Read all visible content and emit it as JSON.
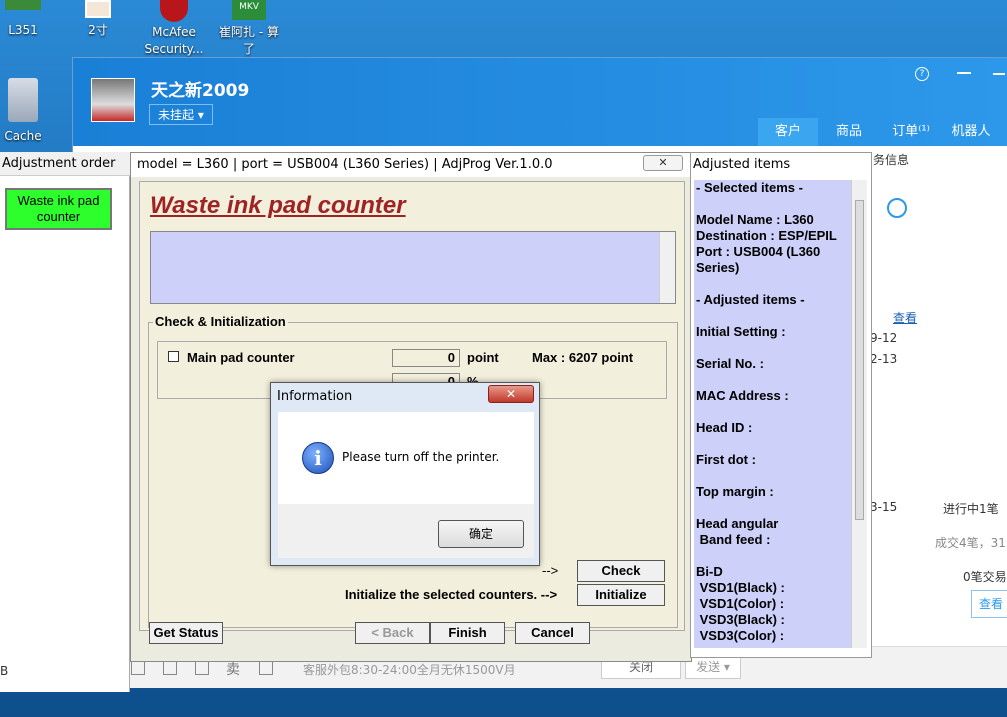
{
  "desktop": {
    "icons": [
      {
        "label": "L351",
        "icon": "app-icon"
      },
      {
        "label": "2寸",
        "icon": "photo-icon"
      },
      {
        "label": "McAfee Security...",
        "icon": "mcafee-shield-icon"
      },
      {
        "label": "崔阿扎 - 算了",
        "icon": "mkv-file-icon"
      },
      {
        "label": "Cache",
        "icon": "folder-icon"
      }
    ]
  },
  "qq": {
    "name": "天之新2009",
    "status": "未挂起 ▾",
    "tabs": [
      "客户",
      "商品",
      "订单⁽¹⁾",
      "机器人"
    ],
    "bottom_text": "客服外包8:30-24:00全月无休1500V月",
    "close_label": "关闭",
    "send_label": "发送 ▾",
    "right": {
      "info_heading": "务信息",
      "view_link": "查看",
      "date1": "9-12",
      "date2": "2-13",
      "date3": "3-15",
      "in_progress": "进行中1笔",
      "deals": "成交4笔，31",
      "deals2": "0笔交易",
      "view_btn": "查看"
    },
    "left_bottom": "B"
  },
  "adjust_order": {
    "title": "Adjustment order",
    "waste_button": "Waste ink pad counter"
  },
  "adjprog": {
    "title": "model = L360 | port = USB004 (L360 Series) | AdjProg Ver.1.0.0",
    "close_glyph": "✕",
    "heading": "Waste ink pad counter",
    "group_label": "Check & Initialization",
    "main_pad_label": "Main pad counter",
    "point_value": "0",
    "point_unit": "point",
    "max_text": "Max : 6207 point",
    "percent_value": "0",
    "percent_unit": "%",
    "check_arrow": "-->",
    "check_button": "Check",
    "initialize_text": "Initialize the selected counters. -->",
    "initialize_button": "Initialize",
    "get_status": "Get Status",
    "back": "< Back",
    "finish": "Finish",
    "cancel": "Cancel"
  },
  "adjusted_items": {
    "title": "Adjusted items",
    "lines": [
      "- Selected items -",
      "",
      "Model Name : L360",
      "Destination : ESP/EPIL",
      "Port : USB004 (L360",
      "Series)",
      "",
      "- Adjusted items -",
      "",
      "Initial Setting :",
      "",
      "Serial No. :",
      "",
      "MAC Address :",
      "",
      "Head ID :",
      "",
      "First dot :",
      "",
      "Top margin :",
      "",
      "Head angular",
      " Band feed :",
      "",
      "Bi-D",
      " VSD1(Black) :",
      " VSD1(Color) :",
      " VSD3(Black) :",
      " VSD3(Color) :"
    ]
  },
  "info_dialog": {
    "title": "Information",
    "close_glyph": "✕",
    "message": "Please turn off the printer.",
    "icon_glyph": "i",
    "ok_label": "确定"
  }
}
